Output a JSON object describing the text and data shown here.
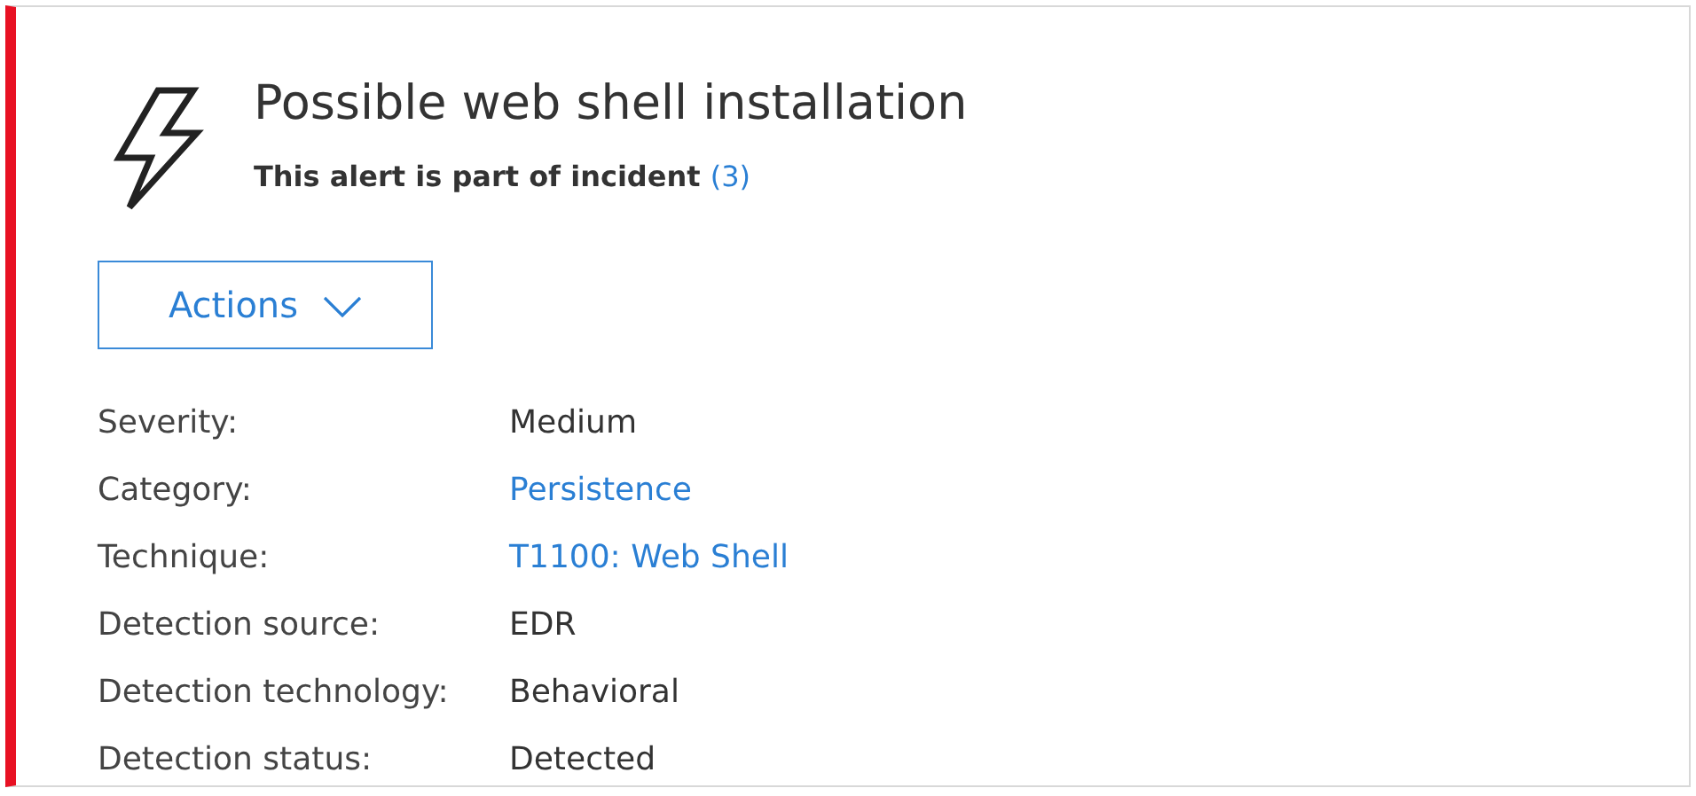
{
  "alert": {
    "title": "Possible web shell installation",
    "incident_text": "This alert is part of incident",
    "incident_link": "(3)"
  },
  "actions_button": {
    "label": "Actions"
  },
  "details": [
    {
      "label": "Severity:",
      "value": "Medium",
      "kind": "text"
    },
    {
      "label": "Category:",
      "value": "Persistence",
      "kind": "link"
    },
    {
      "label": "Technique:",
      "value": "T1100: Web Shell",
      "kind": "link"
    },
    {
      "label": "Detection source:",
      "value": "EDR",
      "kind": "text"
    },
    {
      "label": "Detection technology:",
      "value": "Behavioral",
      "kind": "text"
    },
    {
      "label": "Detection status:",
      "value": "Detected",
      "kind": "text"
    }
  ]
}
